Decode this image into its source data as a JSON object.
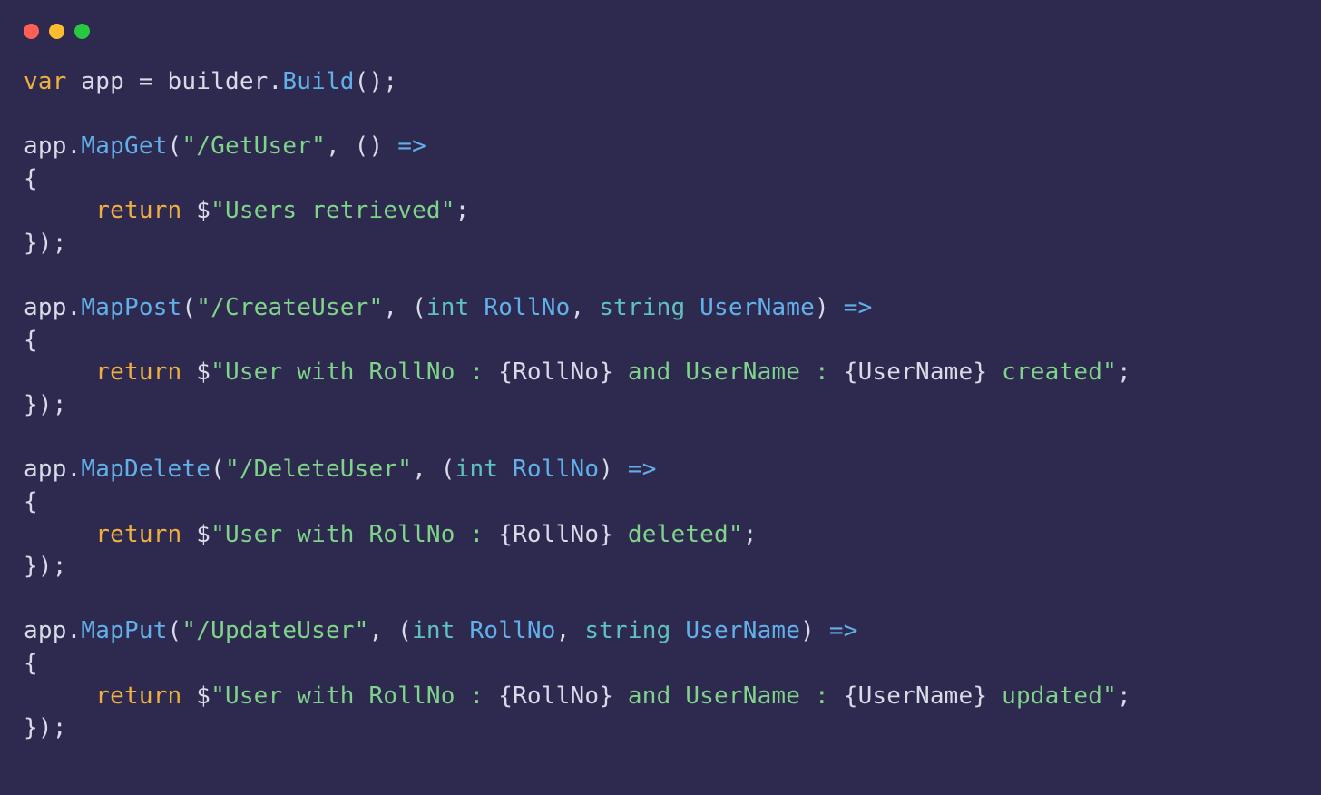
{
  "window": {
    "buttons": {
      "close": "close",
      "minimize": "minimize",
      "maximize": "maximize"
    }
  },
  "code": {
    "l1": {
      "var": "var",
      "app": "app",
      "eq": " = ",
      "builder": "builder",
      "dot1": ".",
      "build": "Build",
      "paren": "();"
    },
    "l2": "",
    "l3": {
      "app": "app",
      "dot": ".",
      "fn": "MapGet",
      "open": "(",
      "route": "\"/GetUser\"",
      "comma": ", () ",
      "arrow": "=>"
    },
    "l4": "{",
    "l5": {
      "indent": "     ",
      "ret": "return",
      "sp": " ",
      "dollar": "$",
      "str": "\"Users retrieved\"",
      "semi": ";"
    },
    "l6": "});",
    "l7": "",
    "l8": {
      "app": "app",
      "dot": ".",
      "fn": "MapPost",
      "open": "(",
      "route": "\"/CreateUser\"",
      "comma": ", (",
      "t1": "int",
      "sp1": " ",
      "p1": "RollNo",
      "c2": ", ",
      "t2": "string",
      "sp2": " ",
      "p2": "UserName",
      "close": ") ",
      "arrow": "=>"
    },
    "l9": "{",
    "l10": {
      "indent": "     ",
      "ret": "return",
      "sp": " ",
      "dollar": "$",
      "s1": "\"User with RollNo : ",
      "ib1o": "{",
      "iv1": "RollNo",
      "ib1c": "}",
      "s2": " and UserName : ",
      "ib2o": "{",
      "iv2": "UserName",
      "ib2c": "}",
      "s3": " created\"",
      "semi": ";"
    },
    "l11": "});",
    "l12": "",
    "l13": {
      "app": "app",
      "dot": ".",
      "fn": "MapDelete",
      "open": "(",
      "route": "\"/DeleteUser\"",
      "comma": ", (",
      "t1": "int",
      "sp1": " ",
      "p1": "RollNo",
      "close": ") ",
      "arrow": "=>"
    },
    "l14": "{",
    "l15": {
      "indent": "     ",
      "ret": "return",
      "sp": " ",
      "dollar": "$",
      "s1": "\"User with RollNo : ",
      "ib1o": "{",
      "iv1": "RollNo",
      "ib1c": "}",
      "s2": " deleted\"",
      "semi": ";"
    },
    "l16": "});",
    "l17": "",
    "l18": {
      "app": "app",
      "dot": ".",
      "fn": "MapPut",
      "open": "(",
      "route": "\"/UpdateUser\"",
      "comma": ", (",
      "t1": "int",
      "sp1": " ",
      "p1": "RollNo",
      "c2": ", ",
      "t2": "string",
      "sp2": " ",
      "p2": "UserName",
      "close": ") ",
      "arrow": "=>"
    },
    "l19": "{",
    "l20": {
      "indent": "     ",
      "ret": "return",
      "sp": " ",
      "dollar": "$",
      "s1": "\"User with RollNo : ",
      "ib1o": "{",
      "iv1": "RollNo",
      "ib1c": "}",
      "s2": " and UserName : ",
      "ib2o": "{",
      "iv2": "UserName",
      "ib2c": "}",
      "s3": " updated\"",
      "semi": ";"
    },
    "l21": "});"
  }
}
